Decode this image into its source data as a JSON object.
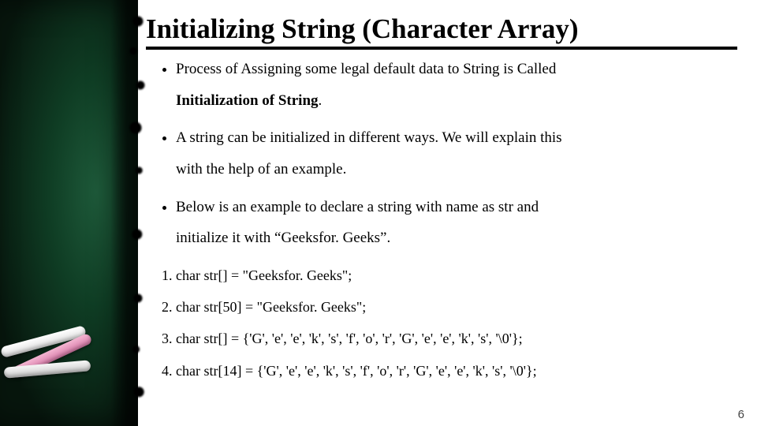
{
  "title": "Initializing String (Character Array)",
  "bullets": {
    "b1_part1": "Process of Assigning some legal default data to String is Called",
    "b1_part2_bold": "Initialization of String",
    "b1_part2_tail": ".",
    "b2_line1": "A string can be initialized in different ways. We will explain this",
    "b2_line2": "with the help of an example.",
    "b3_line1": "Below is an example to declare a string with name as str and",
    "b3_line2": "initialize it with “Geeksfor. Geeks”."
  },
  "examples": {
    "e1": "char str[] = \"Geeksfor. Geeks\";",
    "e2": "char str[50] = \"Geeksfor. Geeks\";",
    "e3": "char str[] = {'G', 'e', 'e', 'k', 's', 'f', 'o', 'r', 'G', 'e', 'e', 'k', 's', '\\0'};",
    "e4": "char str[14] = {'G', 'e', 'e', 'k', 's', 'f', 'o', 'r', 'G', 'e', 'e', 'k', 's', '\\0'};"
  },
  "page_number": "6"
}
